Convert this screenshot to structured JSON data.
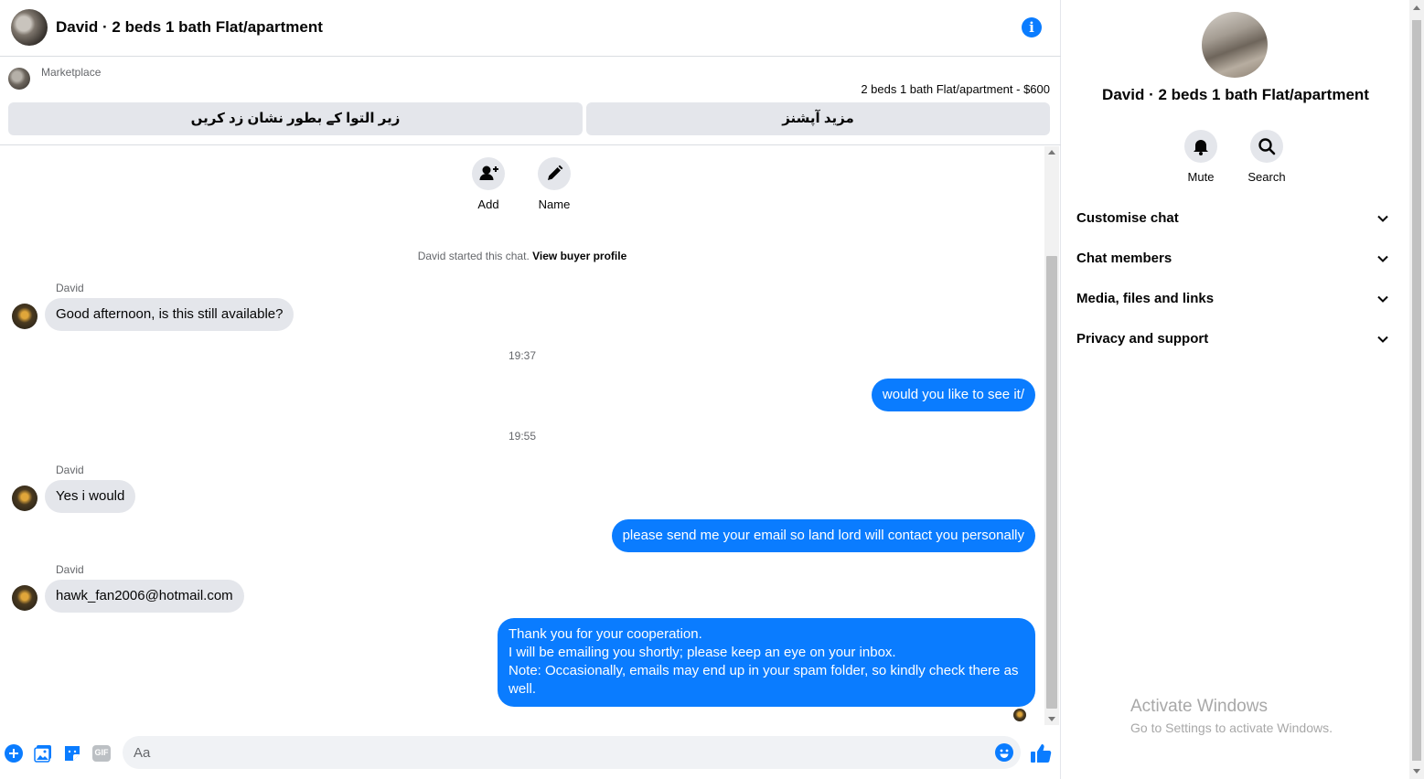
{
  "header": {
    "title": "David · 2 beds 1 bath Flat/apartment",
    "info_icon": "info-icon"
  },
  "marketplace": {
    "label": "Marketplace",
    "listing": "2 beds 1 bath Flat/apartment - $600",
    "mark_button": "زیر التوا کے بطور نشان زد کریں",
    "more_button": "مزید آپشنز"
  },
  "thread": {
    "actions": [
      {
        "label": "Add",
        "icon": "add-person-icon"
      },
      {
        "label": "Name",
        "icon": "pencil-icon"
      }
    ],
    "started_text": "David started this chat.",
    "buyer_profile_link": "View buyer profile",
    "messages": [
      {
        "from": "David",
        "text": "Good afternoon, is this still available?"
      },
      {
        "timestamp": "19:37"
      },
      {
        "from": "me",
        "text": "would you like to see it/"
      },
      {
        "timestamp": "19:55"
      },
      {
        "from": "David",
        "text": "Yes i would"
      },
      {
        "from": "me",
        "text": "please send me your email so land lord will contact you personally"
      },
      {
        "from": "David",
        "text": "hawk_fan2006@hotmail.com"
      },
      {
        "from": "me",
        "lines": [
          "Thank you for your cooperation.",
          "I will be emailing you shortly; please keep an eye on your inbox.",
          "Note: Occasionally, emails may end up in your spam folder, so kindly check there as well."
        ]
      }
    ]
  },
  "composer": {
    "placeholder": "Aa",
    "icons": [
      "plus-icon",
      "photo-icon",
      "sticker-icon",
      "gif-icon",
      "emoji-icon",
      "like-icon"
    ],
    "gif_label": "GIF"
  },
  "panel": {
    "title": "David · 2 beds 1 bath Flat/apartment",
    "actions": [
      {
        "label": "Mute",
        "icon": "bell-icon"
      },
      {
        "label": "Search",
        "icon": "search-icon"
      }
    ],
    "menu": [
      {
        "label": "Customise chat"
      },
      {
        "label": "Chat members"
      },
      {
        "label": "Media, files and links"
      },
      {
        "label": "Privacy and support"
      }
    ]
  },
  "watermark": {
    "line1": "Activate Windows",
    "line2": "Go to Settings to activate Windows."
  },
  "colors": {
    "accent": "#0a7cff",
    "bubble_in": "#e4e6eb",
    "text_secondary": "#65676b"
  }
}
